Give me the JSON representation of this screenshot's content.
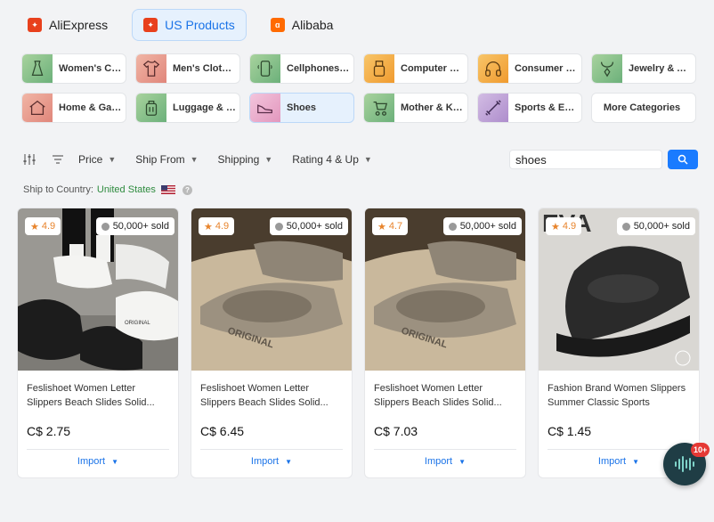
{
  "source_tabs": [
    {
      "label": "AliExpress",
      "active": false
    },
    {
      "label": "US Products",
      "active": true
    },
    {
      "label": "Alibaba",
      "active": false
    }
  ],
  "categories": [
    {
      "label": "Women's Clothing",
      "icon": "dress-icon",
      "color": "#8fbf8a"
    },
    {
      "label": "Men's Clothing",
      "icon": "shirt-icon",
      "color": "#e59a8a"
    },
    {
      "label": "Cellphones & Telecom",
      "icon": "phone-icon",
      "color": "#8fbf8a"
    },
    {
      "label": "Computer & Office",
      "icon": "usb-icon",
      "color": "#f5b04a"
    },
    {
      "label": "Consumer Electronics",
      "icon": "headphones-icon",
      "color": "#f5b04a"
    },
    {
      "label": "Jewelry & Accessories",
      "icon": "necklace-icon",
      "color": "#8fbf8a"
    },
    {
      "label": "Home & Garden",
      "icon": "house-icon",
      "color": "#e59a8a"
    },
    {
      "label": "Luggage & Bags",
      "icon": "luggage-icon",
      "color": "#8fbf8a"
    },
    {
      "label": "Shoes",
      "icon": "shoe-icon",
      "color": "#e8a6c8",
      "active": true
    },
    {
      "label": "Mother & Kids",
      "icon": "stroller-icon",
      "color": "#8fbf8a"
    },
    {
      "label": "Sports & Entertainment",
      "icon": "dumbbell-icon",
      "color": "#c0a2d6"
    },
    {
      "label": "More Categories",
      "icon": "",
      "color": ""
    }
  ],
  "filters": {
    "price": "Price",
    "ship_from": "Ship From",
    "shipping": "Shipping",
    "rating": "Rating 4 & Up"
  },
  "search": {
    "value": "shoes"
  },
  "ship_to": {
    "label": "Ship to Country:",
    "country": "United States"
  },
  "products": [
    {
      "rating": "4.9",
      "sold": "50,000+ sold",
      "title": "Feslishoet Women Letter Slippers Beach Slides Solid...",
      "price": "C$ 2.75",
      "import_label": "Import"
    },
    {
      "rating": "4.9",
      "sold": "50,000+ sold",
      "title": "Feslishoet Women Letter Slippers Beach Slides Solid...",
      "price": "C$ 6.45",
      "import_label": "Import"
    },
    {
      "rating": "4.7",
      "sold": "50,000+ sold",
      "title": "Feslishoet Women Letter Slippers Beach Slides Solid...",
      "price": "C$ 7.03",
      "import_label": "Import"
    },
    {
      "rating": "4.9",
      "sold": "50,000+ sold",
      "title": "Fashion Brand Women Slippers Summer Classic Sports Sandal...",
      "price": "C$ 1.45",
      "import_label": "Import"
    }
  ],
  "notification_count": "10+",
  "colors": {
    "accent": "#1a73e8",
    "search_button": "#1a7bff",
    "rating": "#e8842c",
    "country": "#2e8b3e"
  }
}
